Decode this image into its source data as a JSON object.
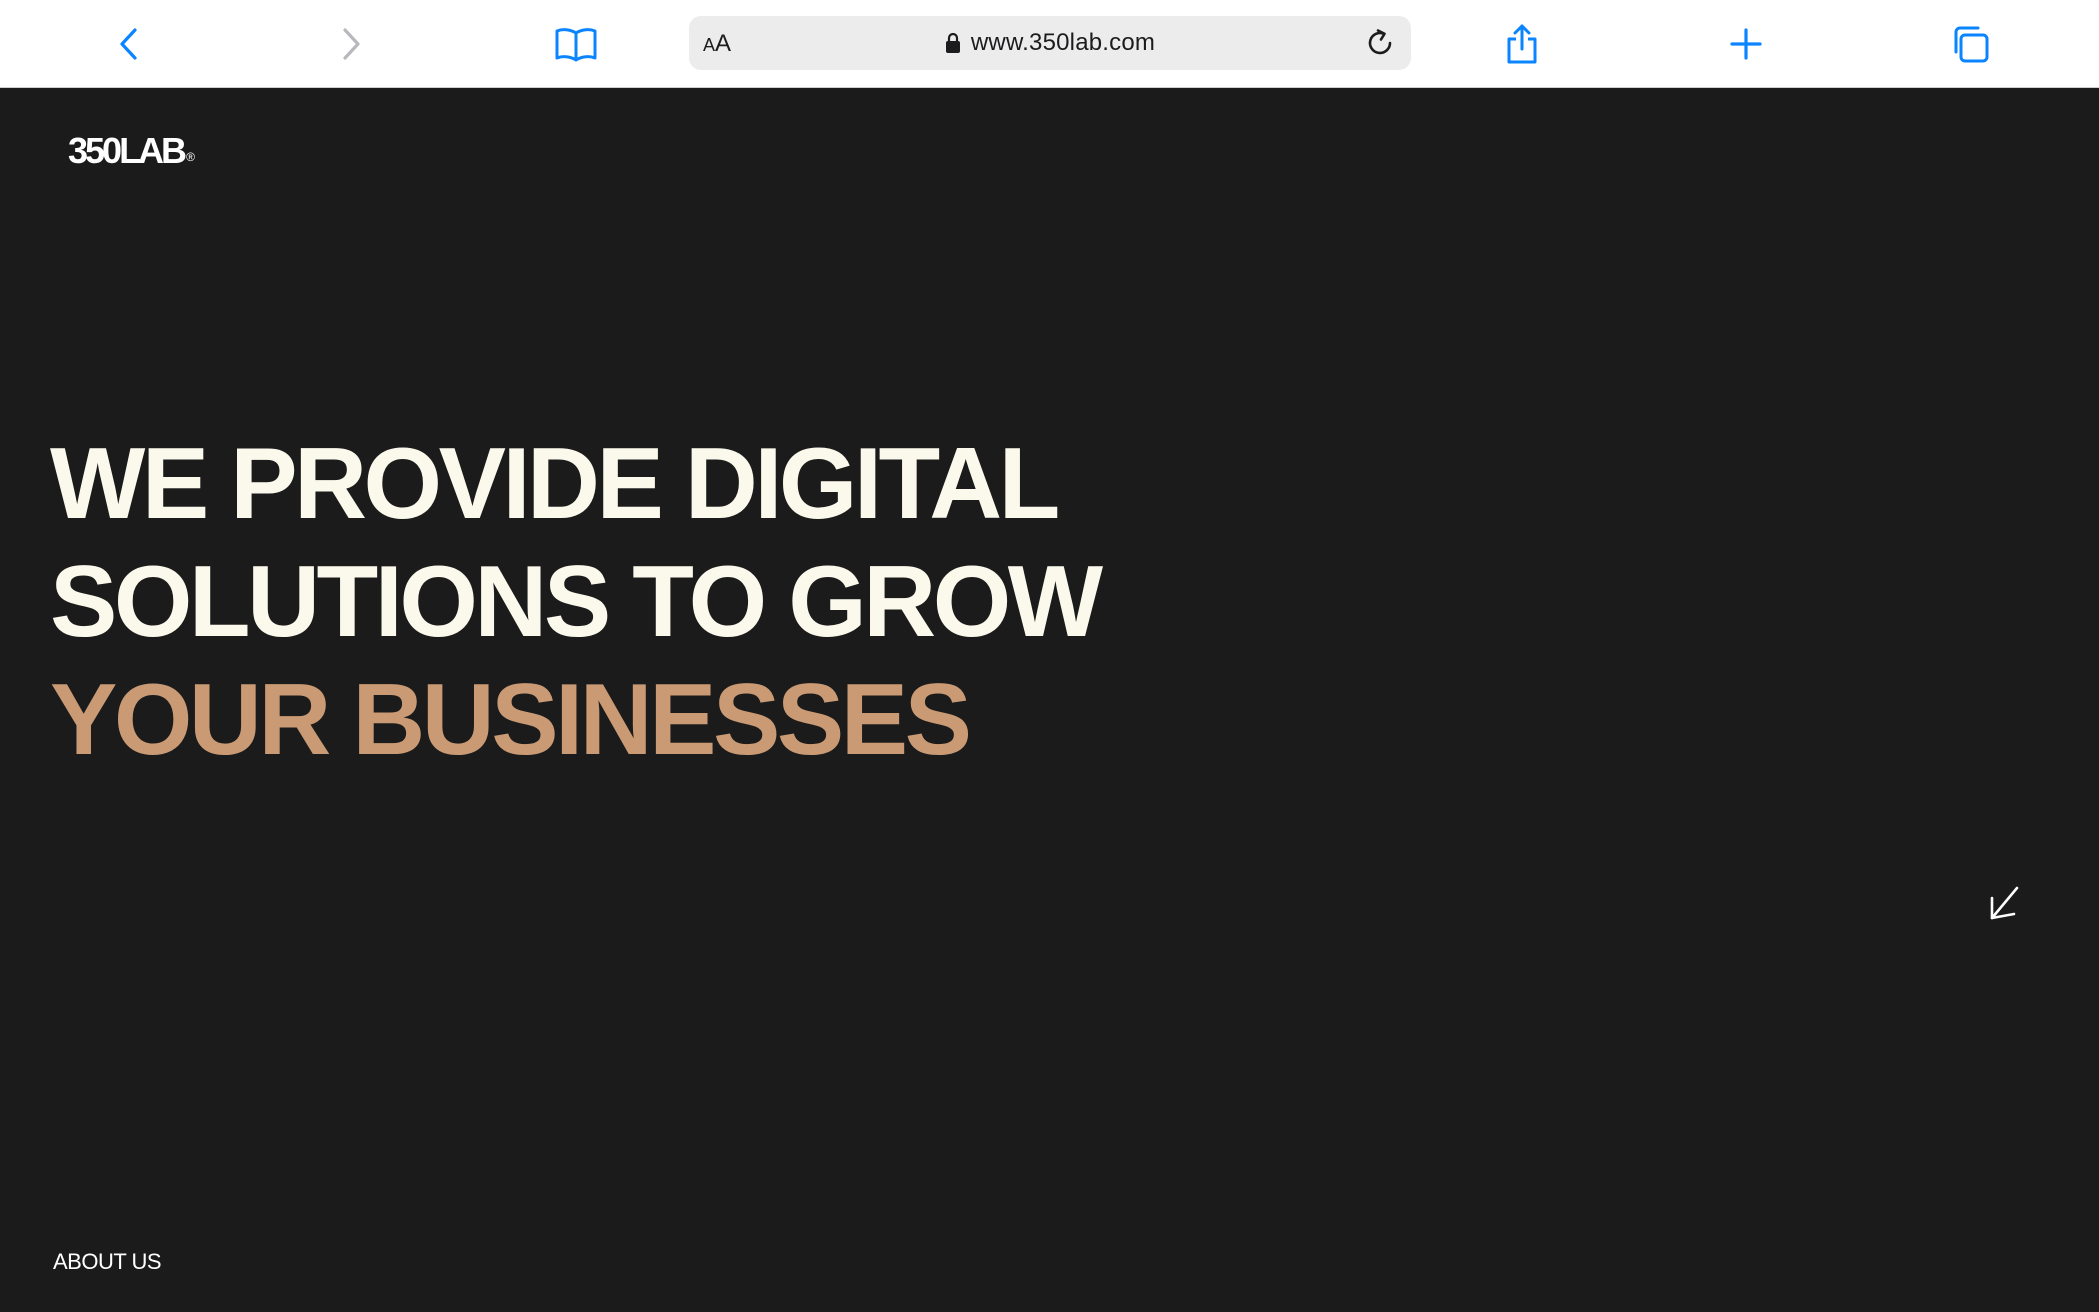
{
  "browser": {
    "aa_small": "A",
    "aa_big": "A",
    "url": "www.350lab.com",
    "accent_color": "#0a84ff",
    "disabled_color": "#b8b8bd",
    "icons": [
      "back-icon",
      "forward-icon",
      "bookmarks-icon",
      "lock-icon",
      "reload-icon",
      "share-icon",
      "new-tab-icon",
      "tabs-icon"
    ]
  },
  "site": {
    "logo_text": "350LAB",
    "logo_mark": "®",
    "hero": {
      "line1": "WE PROVIDE DIGITAL",
      "line2": "SOLUTIONS TO GROW",
      "line3": "YOUR BUSINESSES"
    },
    "about_label": "ABOUT US",
    "scroll_icon": "arrow-down-left-icon",
    "colors": {
      "background": "#1b1b1b",
      "headline": "#fbf8ec",
      "accent": "#c99a74"
    }
  }
}
